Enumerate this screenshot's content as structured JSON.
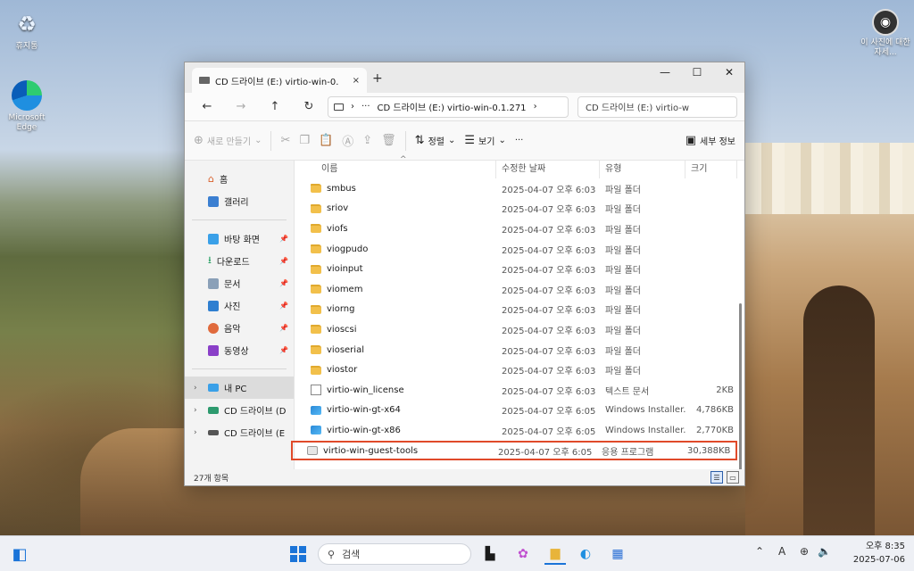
{
  "desktop": {
    "icons": [
      {
        "label": "휴지통"
      },
      {
        "label": "Microsoft Edge"
      },
      {
        "label": "이 사진에 대한 자세..."
      }
    ]
  },
  "window": {
    "tab_label": "CD 드라이브 (E:) virtio-win-0.",
    "tab_close": "×",
    "new_tab": "+",
    "minimize": "—",
    "maximize": "☐",
    "close": "✕",
    "address_path": "CD 드라이브 (E:)  virtio-win-0.1.271",
    "address_more": "···",
    "search_placeholder": "CD 드라이브 (E:) virtio-w",
    "toolbar": {
      "new_label": "새로 만들기",
      "sort_label": "정렬",
      "view_label": "보기",
      "more_label": "···",
      "details_label": "세부 정보"
    },
    "sidebar": {
      "home": "홈",
      "gallery": "갤러리",
      "pinned": [
        {
          "label": "바탕 화면"
        },
        {
          "label": "다운로드"
        },
        {
          "label": "문서"
        },
        {
          "label": "사진"
        },
        {
          "label": "음악"
        },
        {
          "label": "동영상"
        }
      ],
      "this_pc": "내 PC",
      "drive1": "CD 드라이브 (D",
      "drive2": "CD 드라이브 (E"
    },
    "columns": {
      "name": "이름",
      "date": "수정한 날짜",
      "type": "유형",
      "size": "크기"
    },
    "files": [
      {
        "name": "smbus",
        "date": "2025-04-07 오후 6:03",
        "type": "파일 폴더",
        "size": "",
        "icon": "folder"
      },
      {
        "name": "sriov",
        "date": "2025-04-07 오후 6:03",
        "type": "파일 폴더",
        "size": "",
        "icon": "folder"
      },
      {
        "name": "viofs",
        "date": "2025-04-07 오후 6:03",
        "type": "파일 폴더",
        "size": "",
        "icon": "folder"
      },
      {
        "name": "viogpudo",
        "date": "2025-04-07 오후 6:03",
        "type": "파일 폴더",
        "size": "",
        "icon": "folder"
      },
      {
        "name": "vioinput",
        "date": "2025-04-07 오후 6:03",
        "type": "파일 폴더",
        "size": "",
        "icon": "folder"
      },
      {
        "name": "viomem",
        "date": "2025-04-07 오후 6:03",
        "type": "파일 폴더",
        "size": "",
        "icon": "folder"
      },
      {
        "name": "viorng",
        "date": "2025-04-07 오후 6:03",
        "type": "파일 폴더",
        "size": "",
        "icon": "folder"
      },
      {
        "name": "vioscsi",
        "date": "2025-04-07 오후 6:03",
        "type": "파일 폴더",
        "size": "",
        "icon": "folder"
      },
      {
        "name": "vioserial",
        "date": "2025-04-07 오후 6:03",
        "type": "파일 폴더",
        "size": "",
        "icon": "folder"
      },
      {
        "name": "viostor",
        "date": "2025-04-07 오후 6:03",
        "type": "파일 폴더",
        "size": "",
        "icon": "folder"
      },
      {
        "name": "virtio-win_license",
        "date": "2025-04-07 오후 6:03",
        "type": "텍스트 문서",
        "size": "2KB",
        "icon": "text"
      },
      {
        "name": "virtio-win-gt-x64",
        "date": "2025-04-07 오후 6:05",
        "type": "Windows Installer...",
        "size": "4,786KB",
        "icon": "msi"
      },
      {
        "name": "virtio-win-gt-x86",
        "date": "2025-04-07 오후 6:05",
        "type": "Windows Installer...",
        "size": "2,770KB",
        "icon": "msi"
      },
      {
        "name": "virtio-win-guest-tools",
        "date": "2025-04-07 오후 6:05",
        "type": "응용 프로그램",
        "size": "30,388KB",
        "icon": "exe"
      }
    ],
    "status_count": "27개 항목"
  },
  "taskbar": {
    "search_label": "검색",
    "time": "오후 8:35",
    "date": "2025-07-06",
    "tray_lang": "A"
  },
  "colors": {
    "highlight": "#e04a2a",
    "accent": "#1b74d8"
  }
}
